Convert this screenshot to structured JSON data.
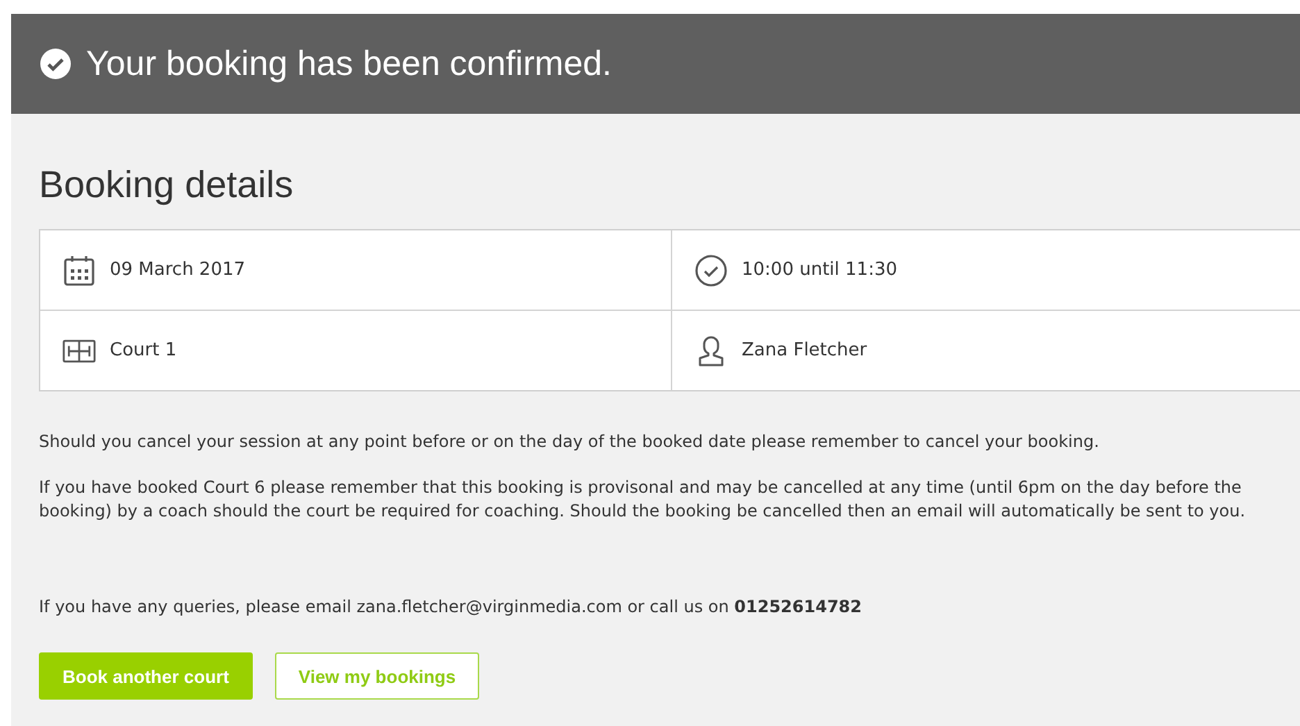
{
  "banner": {
    "title": "Your booking has been confirmed."
  },
  "heading": "Booking details",
  "details": [
    {
      "kind": "date",
      "text": "09 March 2017"
    },
    {
      "kind": "time",
      "text": "10:00 until 11:30"
    },
    {
      "kind": "court",
      "text": "Court 1"
    },
    {
      "kind": "person",
      "text": "Zana Fletcher"
    }
  ],
  "notes": [
    "Should you cancel your session at any point before or on the day of the booked date please remember to cancel your booking.",
    "If you have booked Court 6 please remember that this booking is provisonal and may be cancelled at any time (until 6pm on the day before the booking) by a coach should the court be required for coaching. Should the booking be cancelled then an email will automatically be sent to you."
  ],
  "contact": "If you have any queries, please email zana.fletcher@virginmedia.com or call us on **01252614782**",
  "buttons": [
    {
      "kind": "primary",
      "label": "Book another court"
    },
    {
      "kind": "secondary",
      "label": "View my bookings"
    }
  ]
}
